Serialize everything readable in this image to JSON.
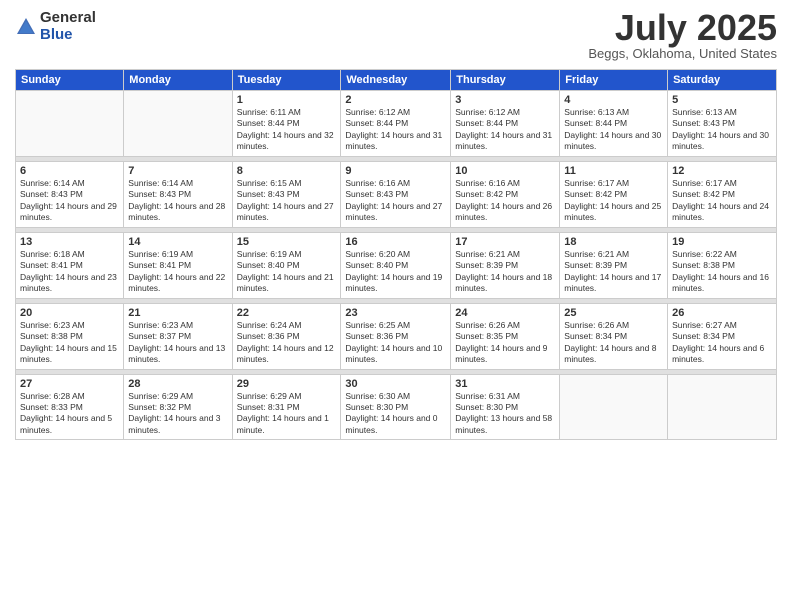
{
  "logo": {
    "general": "General",
    "blue": "Blue"
  },
  "title": "July 2025",
  "location": "Beggs, Oklahoma, United States",
  "days_of_week": [
    "Sunday",
    "Monday",
    "Tuesday",
    "Wednesday",
    "Thursday",
    "Friday",
    "Saturday"
  ],
  "weeks": [
    [
      {
        "day": "",
        "info": ""
      },
      {
        "day": "",
        "info": ""
      },
      {
        "day": "1",
        "info": "Sunrise: 6:11 AM\nSunset: 8:44 PM\nDaylight: 14 hours and 32 minutes."
      },
      {
        "day": "2",
        "info": "Sunrise: 6:12 AM\nSunset: 8:44 PM\nDaylight: 14 hours and 31 minutes."
      },
      {
        "day": "3",
        "info": "Sunrise: 6:12 AM\nSunset: 8:44 PM\nDaylight: 14 hours and 31 minutes."
      },
      {
        "day": "4",
        "info": "Sunrise: 6:13 AM\nSunset: 8:44 PM\nDaylight: 14 hours and 30 minutes."
      },
      {
        "day": "5",
        "info": "Sunrise: 6:13 AM\nSunset: 8:43 PM\nDaylight: 14 hours and 30 minutes."
      }
    ],
    [
      {
        "day": "6",
        "info": "Sunrise: 6:14 AM\nSunset: 8:43 PM\nDaylight: 14 hours and 29 minutes."
      },
      {
        "day": "7",
        "info": "Sunrise: 6:14 AM\nSunset: 8:43 PM\nDaylight: 14 hours and 28 minutes."
      },
      {
        "day": "8",
        "info": "Sunrise: 6:15 AM\nSunset: 8:43 PM\nDaylight: 14 hours and 27 minutes."
      },
      {
        "day": "9",
        "info": "Sunrise: 6:16 AM\nSunset: 8:43 PM\nDaylight: 14 hours and 27 minutes."
      },
      {
        "day": "10",
        "info": "Sunrise: 6:16 AM\nSunset: 8:42 PM\nDaylight: 14 hours and 26 minutes."
      },
      {
        "day": "11",
        "info": "Sunrise: 6:17 AM\nSunset: 8:42 PM\nDaylight: 14 hours and 25 minutes."
      },
      {
        "day": "12",
        "info": "Sunrise: 6:17 AM\nSunset: 8:42 PM\nDaylight: 14 hours and 24 minutes."
      }
    ],
    [
      {
        "day": "13",
        "info": "Sunrise: 6:18 AM\nSunset: 8:41 PM\nDaylight: 14 hours and 23 minutes."
      },
      {
        "day": "14",
        "info": "Sunrise: 6:19 AM\nSunset: 8:41 PM\nDaylight: 14 hours and 22 minutes."
      },
      {
        "day": "15",
        "info": "Sunrise: 6:19 AM\nSunset: 8:40 PM\nDaylight: 14 hours and 21 minutes."
      },
      {
        "day": "16",
        "info": "Sunrise: 6:20 AM\nSunset: 8:40 PM\nDaylight: 14 hours and 19 minutes."
      },
      {
        "day": "17",
        "info": "Sunrise: 6:21 AM\nSunset: 8:39 PM\nDaylight: 14 hours and 18 minutes."
      },
      {
        "day": "18",
        "info": "Sunrise: 6:21 AM\nSunset: 8:39 PM\nDaylight: 14 hours and 17 minutes."
      },
      {
        "day": "19",
        "info": "Sunrise: 6:22 AM\nSunset: 8:38 PM\nDaylight: 14 hours and 16 minutes."
      }
    ],
    [
      {
        "day": "20",
        "info": "Sunrise: 6:23 AM\nSunset: 8:38 PM\nDaylight: 14 hours and 15 minutes."
      },
      {
        "day": "21",
        "info": "Sunrise: 6:23 AM\nSunset: 8:37 PM\nDaylight: 14 hours and 13 minutes."
      },
      {
        "day": "22",
        "info": "Sunrise: 6:24 AM\nSunset: 8:36 PM\nDaylight: 14 hours and 12 minutes."
      },
      {
        "day": "23",
        "info": "Sunrise: 6:25 AM\nSunset: 8:36 PM\nDaylight: 14 hours and 10 minutes."
      },
      {
        "day": "24",
        "info": "Sunrise: 6:26 AM\nSunset: 8:35 PM\nDaylight: 14 hours and 9 minutes."
      },
      {
        "day": "25",
        "info": "Sunrise: 6:26 AM\nSunset: 8:34 PM\nDaylight: 14 hours and 8 minutes."
      },
      {
        "day": "26",
        "info": "Sunrise: 6:27 AM\nSunset: 8:34 PM\nDaylight: 14 hours and 6 minutes."
      }
    ],
    [
      {
        "day": "27",
        "info": "Sunrise: 6:28 AM\nSunset: 8:33 PM\nDaylight: 14 hours and 5 minutes."
      },
      {
        "day": "28",
        "info": "Sunrise: 6:29 AM\nSunset: 8:32 PM\nDaylight: 14 hours and 3 minutes."
      },
      {
        "day": "29",
        "info": "Sunrise: 6:29 AM\nSunset: 8:31 PM\nDaylight: 14 hours and 1 minute."
      },
      {
        "day": "30",
        "info": "Sunrise: 6:30 AM\nSunset: 8:30 PM\nDaylight: 14 hours and 0 minutes."
      },
      {
        "day": "31",
        "info": "Sunrise: 6:31 AM\nSunset: 8:30 PM\nDaylight: 13 hours and 58 minutes."
      },
      {
        "day": "",
        "info": ""
      },
      {
        "day": "",
        "info": ""
      }
    ]
  ]
}
